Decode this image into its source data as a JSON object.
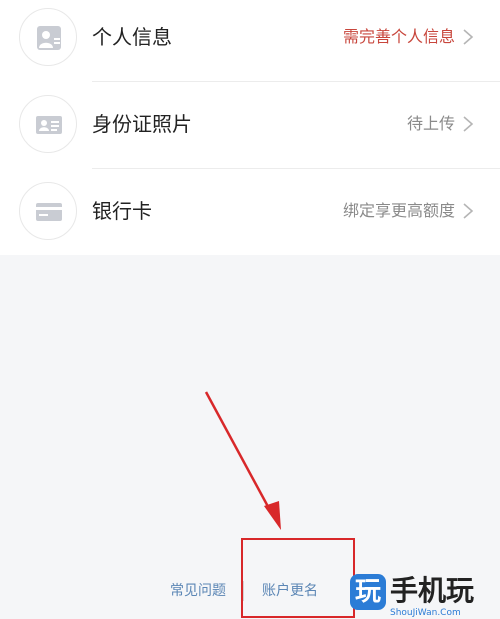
{
  "list": {
    "items": [
      {
        "title": "个人信息",
        "status": "需完善个人信息",
        "icon": "person-id-icon",
        "status_color": "#c8463c"
      },
      {
        "title": "身份证照片",
        "status": "待上传",
        "icon": "id-card-icon",
        "status_color": "#8a8a8a"
      },
      {
        "title": "银行卡",
        "status": "绑定享更高额度",
        "icon": "bank-card-icon",
        "status_color": "#8a8a8a"
      }
    ]
  },
  "footer": {
    "faq_label": "常见问题",
    "rename_label": "账户更名",
    "link_color": "#5b86b5"
  },
  "annotation": {
    "color": "#d8282a"
  },
  "watermark": {
    "logo_char": "玩",
    "name": "手机玩",
    "url": "ShouJiWan.Com",
    "brand_color": "#2b7cd6"
  }
}
